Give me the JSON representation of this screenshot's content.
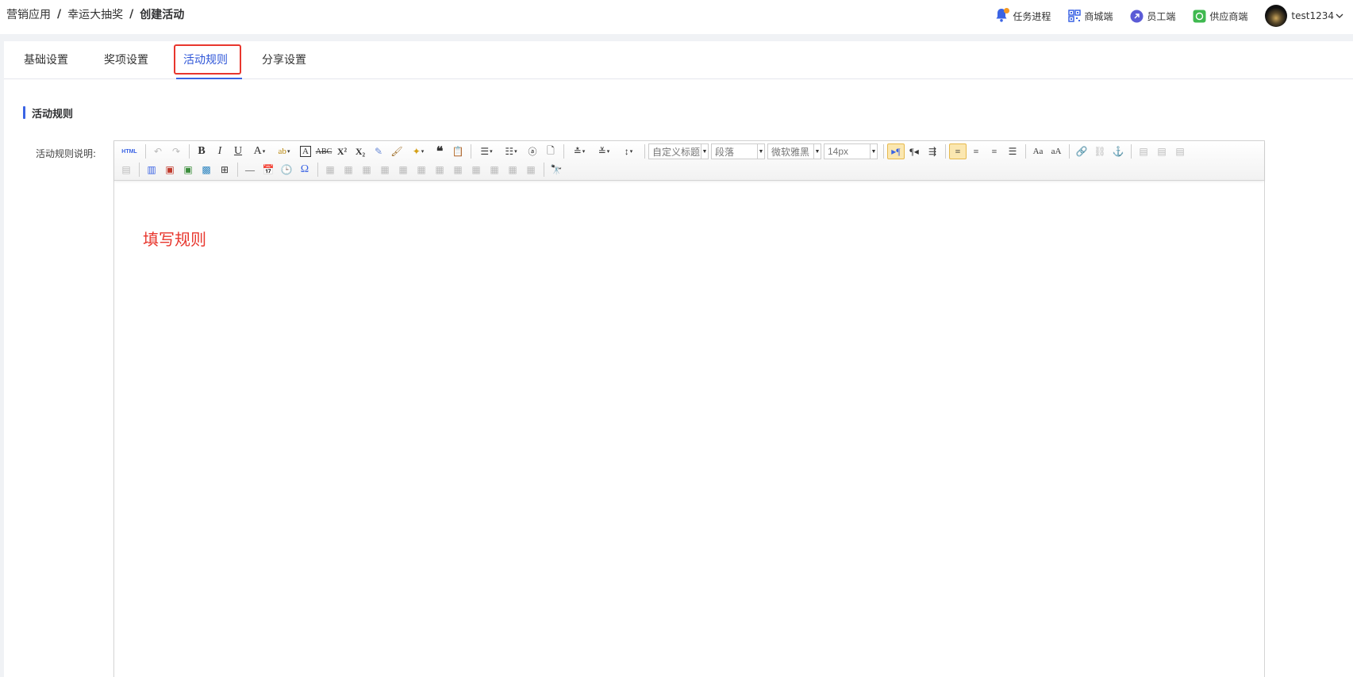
{
  "breadcrumb": {
    "items": [
      "营销应用",
      "幸运大抽奖",
      "创建活动"
    ],
    "separator": "/"
  },
  "top_links": {
    "tasks": "任务进程",
    "mall": "商城端",
    "staff": "员工端",
    "supplier": "供应商端",
    "username": "test1234"
  },
  "tabs": [
    {
      "label": "基础设置"
    },
    {
      "label": "奖项设置"
    },
    {
      "label": "活动规则",
      "active": true
    },
    {
      "label": "分享设置"
    }
  ],
  "section": {
    "title": "活动规则",
    "field_label": "活动规则说明:"
  },
  "editor": {
    "html_button": "HTML",
    "heading_combo": "自定义标题",
    "paragraph_combo": "段落",
    "font_combo": "微软雅黑",
    "size_combo": "14px",
    "content": "填写规则"
  },
  "colors": {
    "accent": "#3b64e4",
    "highlight_border": "#e8362d",
    "content_text": "#e8362d",
    "notification_dot": "#f59a23"
  }
}
